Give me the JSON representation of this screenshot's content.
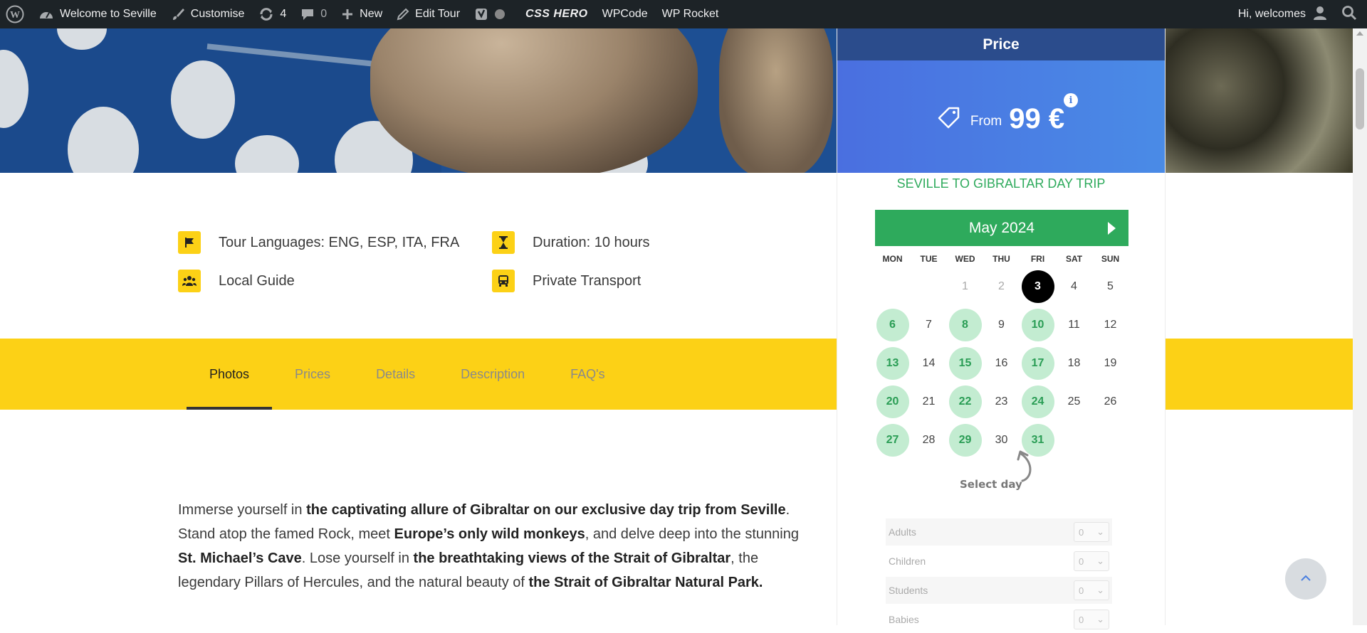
{
  "adminbar": {
    "site_name": "Welcome to Seville",
    "customise": "Customise",
    "updates_count": "4",
    "comments_count": "0",
    "new": "New",
    "edit": "Edit Tour",
    "csshero": "CSS HERO",
    "wpcode": "WPCode",
    "wprocket": "WP Rocket",
    "greeting": "Hi, welcomes"
  },
  "features": [
    {
      "icon": "flag-icon",
      "label": "Tour Languages: ENG, ESP, ITA, FRA"
    },
    {
      "icon": "hourglass-icon",
      "label": "Duration: 10 hours"
    },
    {
      "icon": "users-icon",
      "label": "Local Guide"
    },
    {
      "icon": "bus-icon",
      "label": "Private Transport"
    }
  ],
  "tabs": [
    {
      "label": "Photos",
      "active": true
    },
    {
      "label": "Prices"
    },
    {
      "label": "Details"
    },
    {
      "label": "Description"
    },
    {
      "label": "FAQ's"
    }
  ],
  "description": {
    "p1": "Immerse yourself in ",
    "b1": "the captivating allure of Gibraltar on our exclusive day trip from Seville",
    "p2": ". Stand atop the famed Rock, meet ",
    "b2": "Europe’s only wild monkeys",
    "p3": ", and delve deep into the stunning ",
    "b3": "St. Michael’s Cave",
    "p4": ". Lose yourself in ",
    "b4": "the breathtaking views of the Strait of Gibraltar",
    "p5": ", the legendary Pillars of Hercules, and the natural beauty of ",
    "b5": "the Strait of Gibraltar Natural Park."
  },
  "booking": {
    "heading": "Price",
    "price_prefix": "From",
    "price": "99 €",
    "info": "i",
    "trip_title": "SEVILLE TO GIBRALTAR DAY TRIP",
    "calendar": {
      "month": "May 2024",
      "weekdays": [
        "MON",
        "TUE",
        "WED",
        "THU",
        "FRI",
        "SAT",
        "SUN"
      ],
      "leading_blanks": 2,
      "days": [
        {
          "d": "1",
          "s": "past"
        },
        {
          "d": "2",
          "s": "past"
        },
        {
          "d": "3",
          "s": "today"
        },
        {
          "d": "4",
          "s": ""
        },
        {
          "d": "5",
          "s": ""
        },
        {
          "d": "6",
          "s": "avail"
        },
        {
          "d": "7",
          "s": ""
        },
        {
          "d": "8",
          "s": "avail"
        },
        {
          "d": "9",
          "s": ""
        },
        {
          "d": "10",
          "s": "avail"
        },
        {
          "d": "11",
          "s": ""
        },
        {
          "d": "12",
          "s": ""
        },
        {
          "d": "13",
          "s": "avail"
        },
        {
          "d": "14",
          "s": ""
        },
        {
          "d": "15",
          "s": "avail"
        },
        {
          "d": "16",
          "s": ""
        },
        {
          "d": "17",
          "s": "avail"
        },
        {
          "d": "18",
          "s": ""
        },
        {
          "d": "19",
          "s": ""
        },
        {
          "d": "20",
          "s": "avail"
        },
        {
          "d": "21",
          "s": ""
        },
        {
          "d": "22",
          "s": "avail"
        },
        {
          "d": "23",
          "s": ""
        },
        {
          "d": "24",
          "s": "avail"
        },
        {
          "d": "25",
          "s": ""
        },
        {
          "d": "26",
          "s": ""
        },
        {
          "d": "27",
          "s": "avail"
        },
        {
          "d": "28",
          "s": ""
        },
        {
          "d": "29",
          "s": "avail"
        },
        {
          "d": "30",
          "s": ""
        },
        {
          "d": "31",
          "s": "avail"
        }
      ],
      "select_hint": "Select day"
    },
    "passengers": [
      {
        "label": "Adults",
        "value": "0"
      },
      {
        "label": "Children",
        "value": "0"
      },
      {
        "label": "Students",
        "value": "0"
      },
      {
        "label": "Babies",
        "value": "0"
      }
    ]
  },
  "colors": {
    "yellow": "#fcd116",
    "green": "#2eaa5c",
    "blue": "#4a7fe0",
    "navy": "#2b4c8c"
  }
}
